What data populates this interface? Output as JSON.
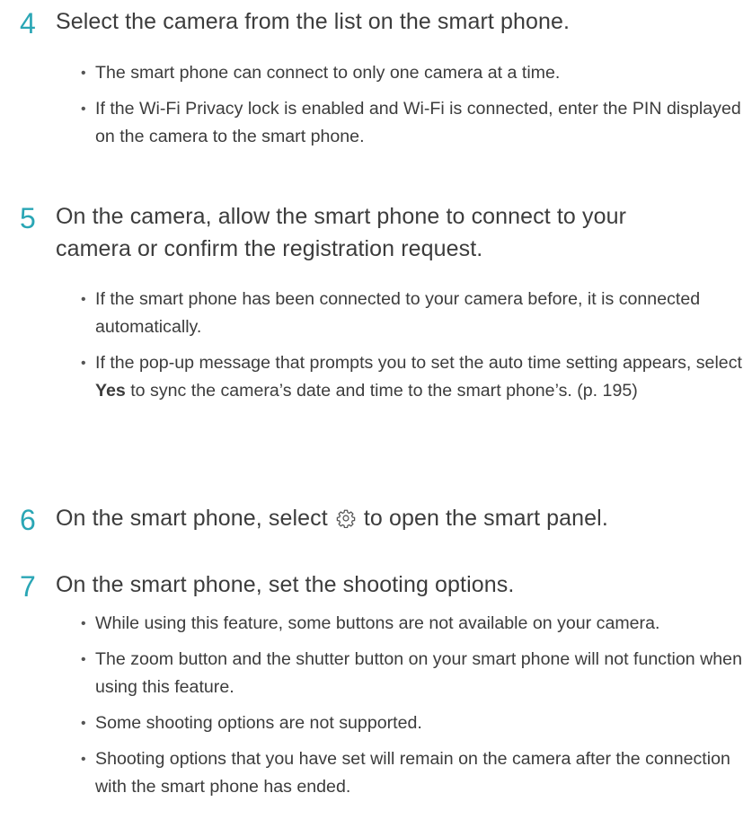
{
  "step4": {
    "number": "4",
    "title": "Select the camera from the list on the smart phone.",
    "bullets": [
      "The smart phone can connect to only one camera at a time.",
      "If the Wi-Fi Privacy lock is enabled and Wi-Fi is connected, enter the PIN displayed on the camera to the smart phone."
    ]
  },
  "step5": {
    "number": "5",
    "title": "On the camera, allow the smart phone to connect to your camera or confirm the registration request.",
    "bullet1": "If the smart phone has been connected to your camera before, it is connected automatically.",
    "bullet2_before": "If the pop-up message that prompts you to set the auto time setting appears, select ",
    "bullet2_bold": "Yes",
    "bullet2_after": " to sync the camera’s date and time to the smart phone’s. (p. 195)"
  },
  "step6": {
    "number": "6",
    "title_before": "On the smart phone, select ",
    "icon": "gear-icon",
    "title_after": " to open the smart panel."
  },
  "step7": {
    "number": "7",
    "title": "On the smart phone, set the shooting options.",
    "bullets": [
      "While using this feature, some buttons are not available on your camera.",
      "The zoom button and the shutter button on your smart phone will not function when using this feature.",
      "Some shooting options are not supported.",
      "Shooting options that you have set will remain on the camera after the connection with the smart phone has ended."
    ]
  },
  "colors": {
    "step_number": "#2aa6b5",
    "text": "#3c3c3c"
  }
}
